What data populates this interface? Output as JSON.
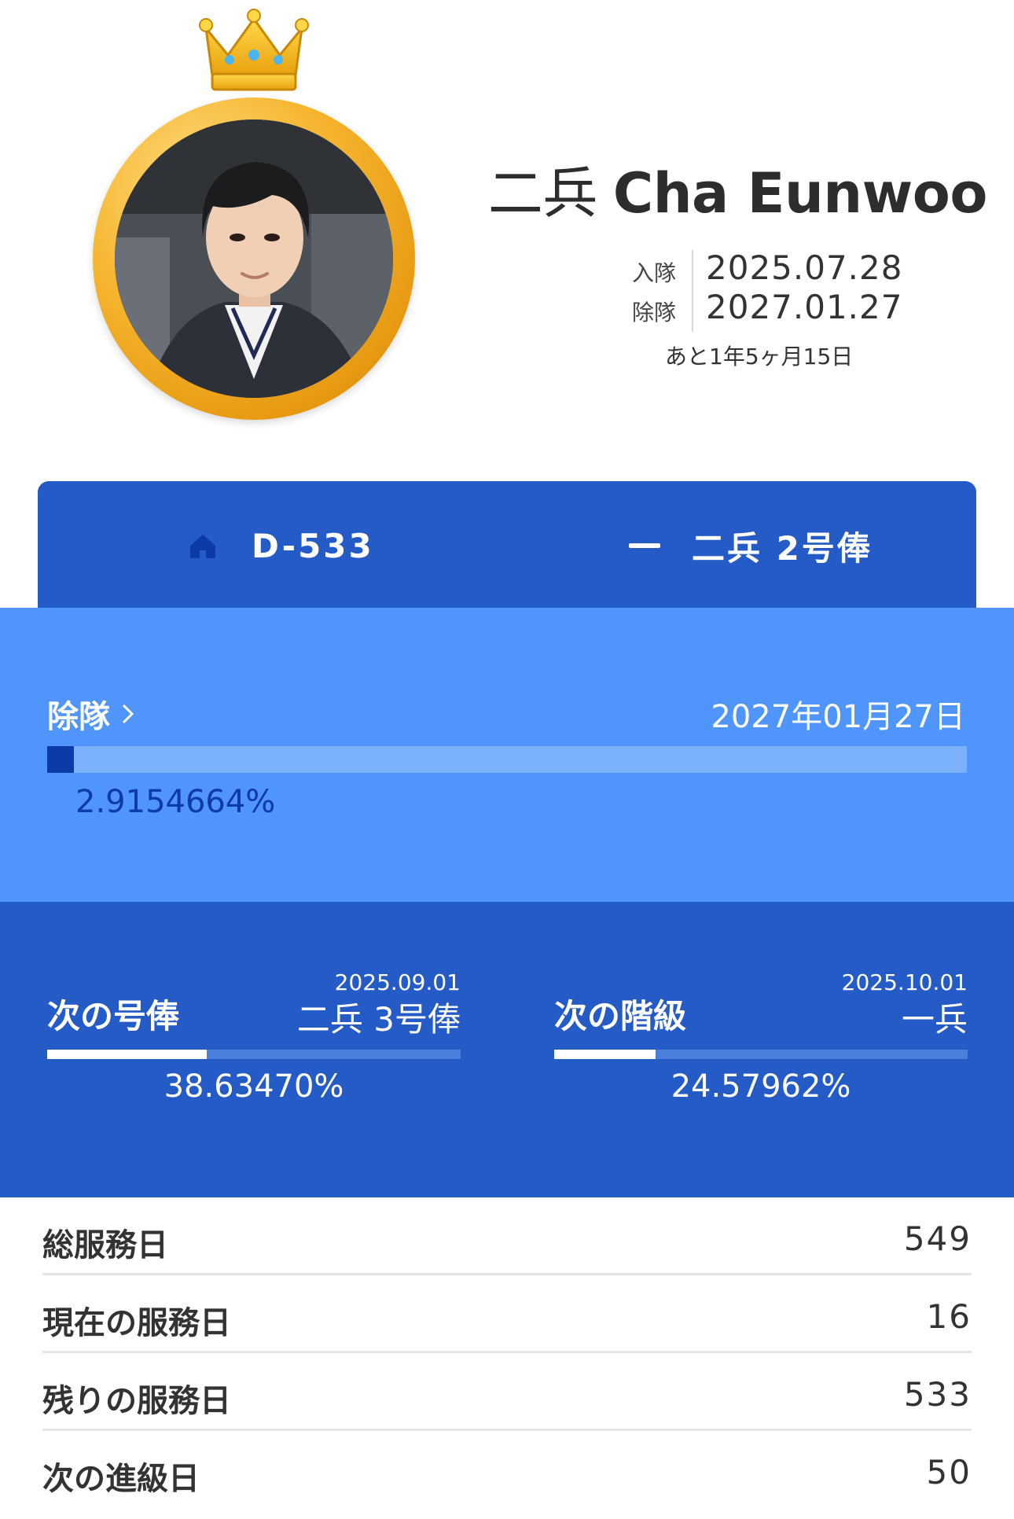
{
  "profile": {
    "rank": "二兵",
    "name": "Cha Eunwoo",
    "enlist_label": "入隊",
    "enlist_date": "2025.07.28",
    "discharge_label": "除隊",
    "discharge_date": "2027.01.27",
    "remaining": "あと1年5ヶ月15日"
  },
  "tabs": {
    "dday": "D-533",
    "pay_grade": "二兵 2号俸",
    "dday_icon": "home-icon",
    "pay_icon": "dash-icon"
  },
  "discharge": {
    "label": "除隊",
    "date": "2027年01月27日",
    "percent_text": "2.9154664%",
    "progress": 0.029154664
  },
  "next_pay": {
    "title": "次の号俸",
    "date": "2025.09.01",
    "target": "二兵 3号俸",
    "percent_text": "38.63470%",
    "progress": 0.386347
  },
  "next_rank": {
    "title": "次の階級",
    "date": "2025.10.01",
    "target": "一兵",
    "percent_text": "24.57962%",
    "progress": 0.2457962
  },
  "stats": [
    {
      "label": "総服務日",
      "value": "549"
    },
    {
      "label": "現在の服務日",
      "value": "16"
    },
    {
      "label": "残りの服務日",
      "value": "533"
    },
    {
      "label": "次の進級日",
      "value": "50"
    }
  ],
  "colors": {
    "primary_blue": "#245bc6",
    "light_blue": "#4f95fb",
    "dark_blue": "#0d3aa6",
    "gold": "#f7b733"
  }
}
